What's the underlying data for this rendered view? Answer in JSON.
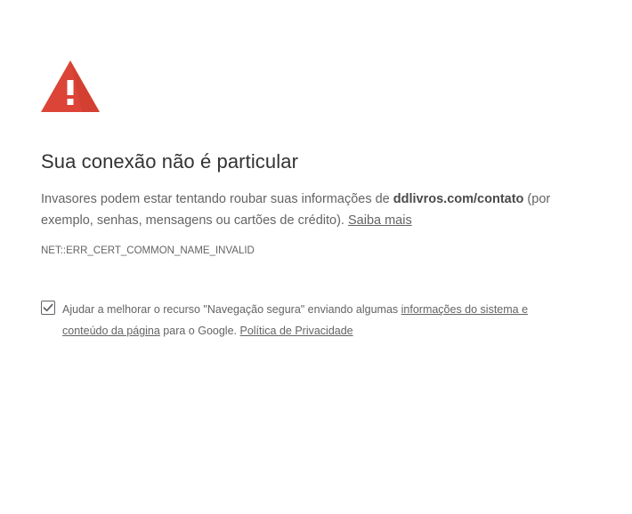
{
  "icons": {
    "warning": "warning-triangle-icon",
    "check": "checkmark-icon"
  },
  "colors": {
    "warning_red": "#db4437",
    "text": "#646464",
    "title": "#333333"
  },
  "heading": {
    "title": "Sua conexão não é particular"
  },
  "description": {
    "text_before": "Invasores podem estar tentando roubar suas informações de ",
    "domain": "ddlivros.com/contato",
    "text_after": " (por exemplo, senhas, mensagens ou cartões de crédito). ",
    "learn_more_link": "Saiba mais"
  },
  "error_code": "NET::ERR_CERT_COMMON_NAME_INVALID",
  "report": {
    "checked": true,
    "text_before": "Ajudar a melhorar o recurso \"Navegação segura\" enviando algumas ",
    "system_info_link": "informações do sistema e conteúdo da página",
    "text_middle": " para o Google. ",
    "privacy_link": "Política de Privacidade"
  }
}
